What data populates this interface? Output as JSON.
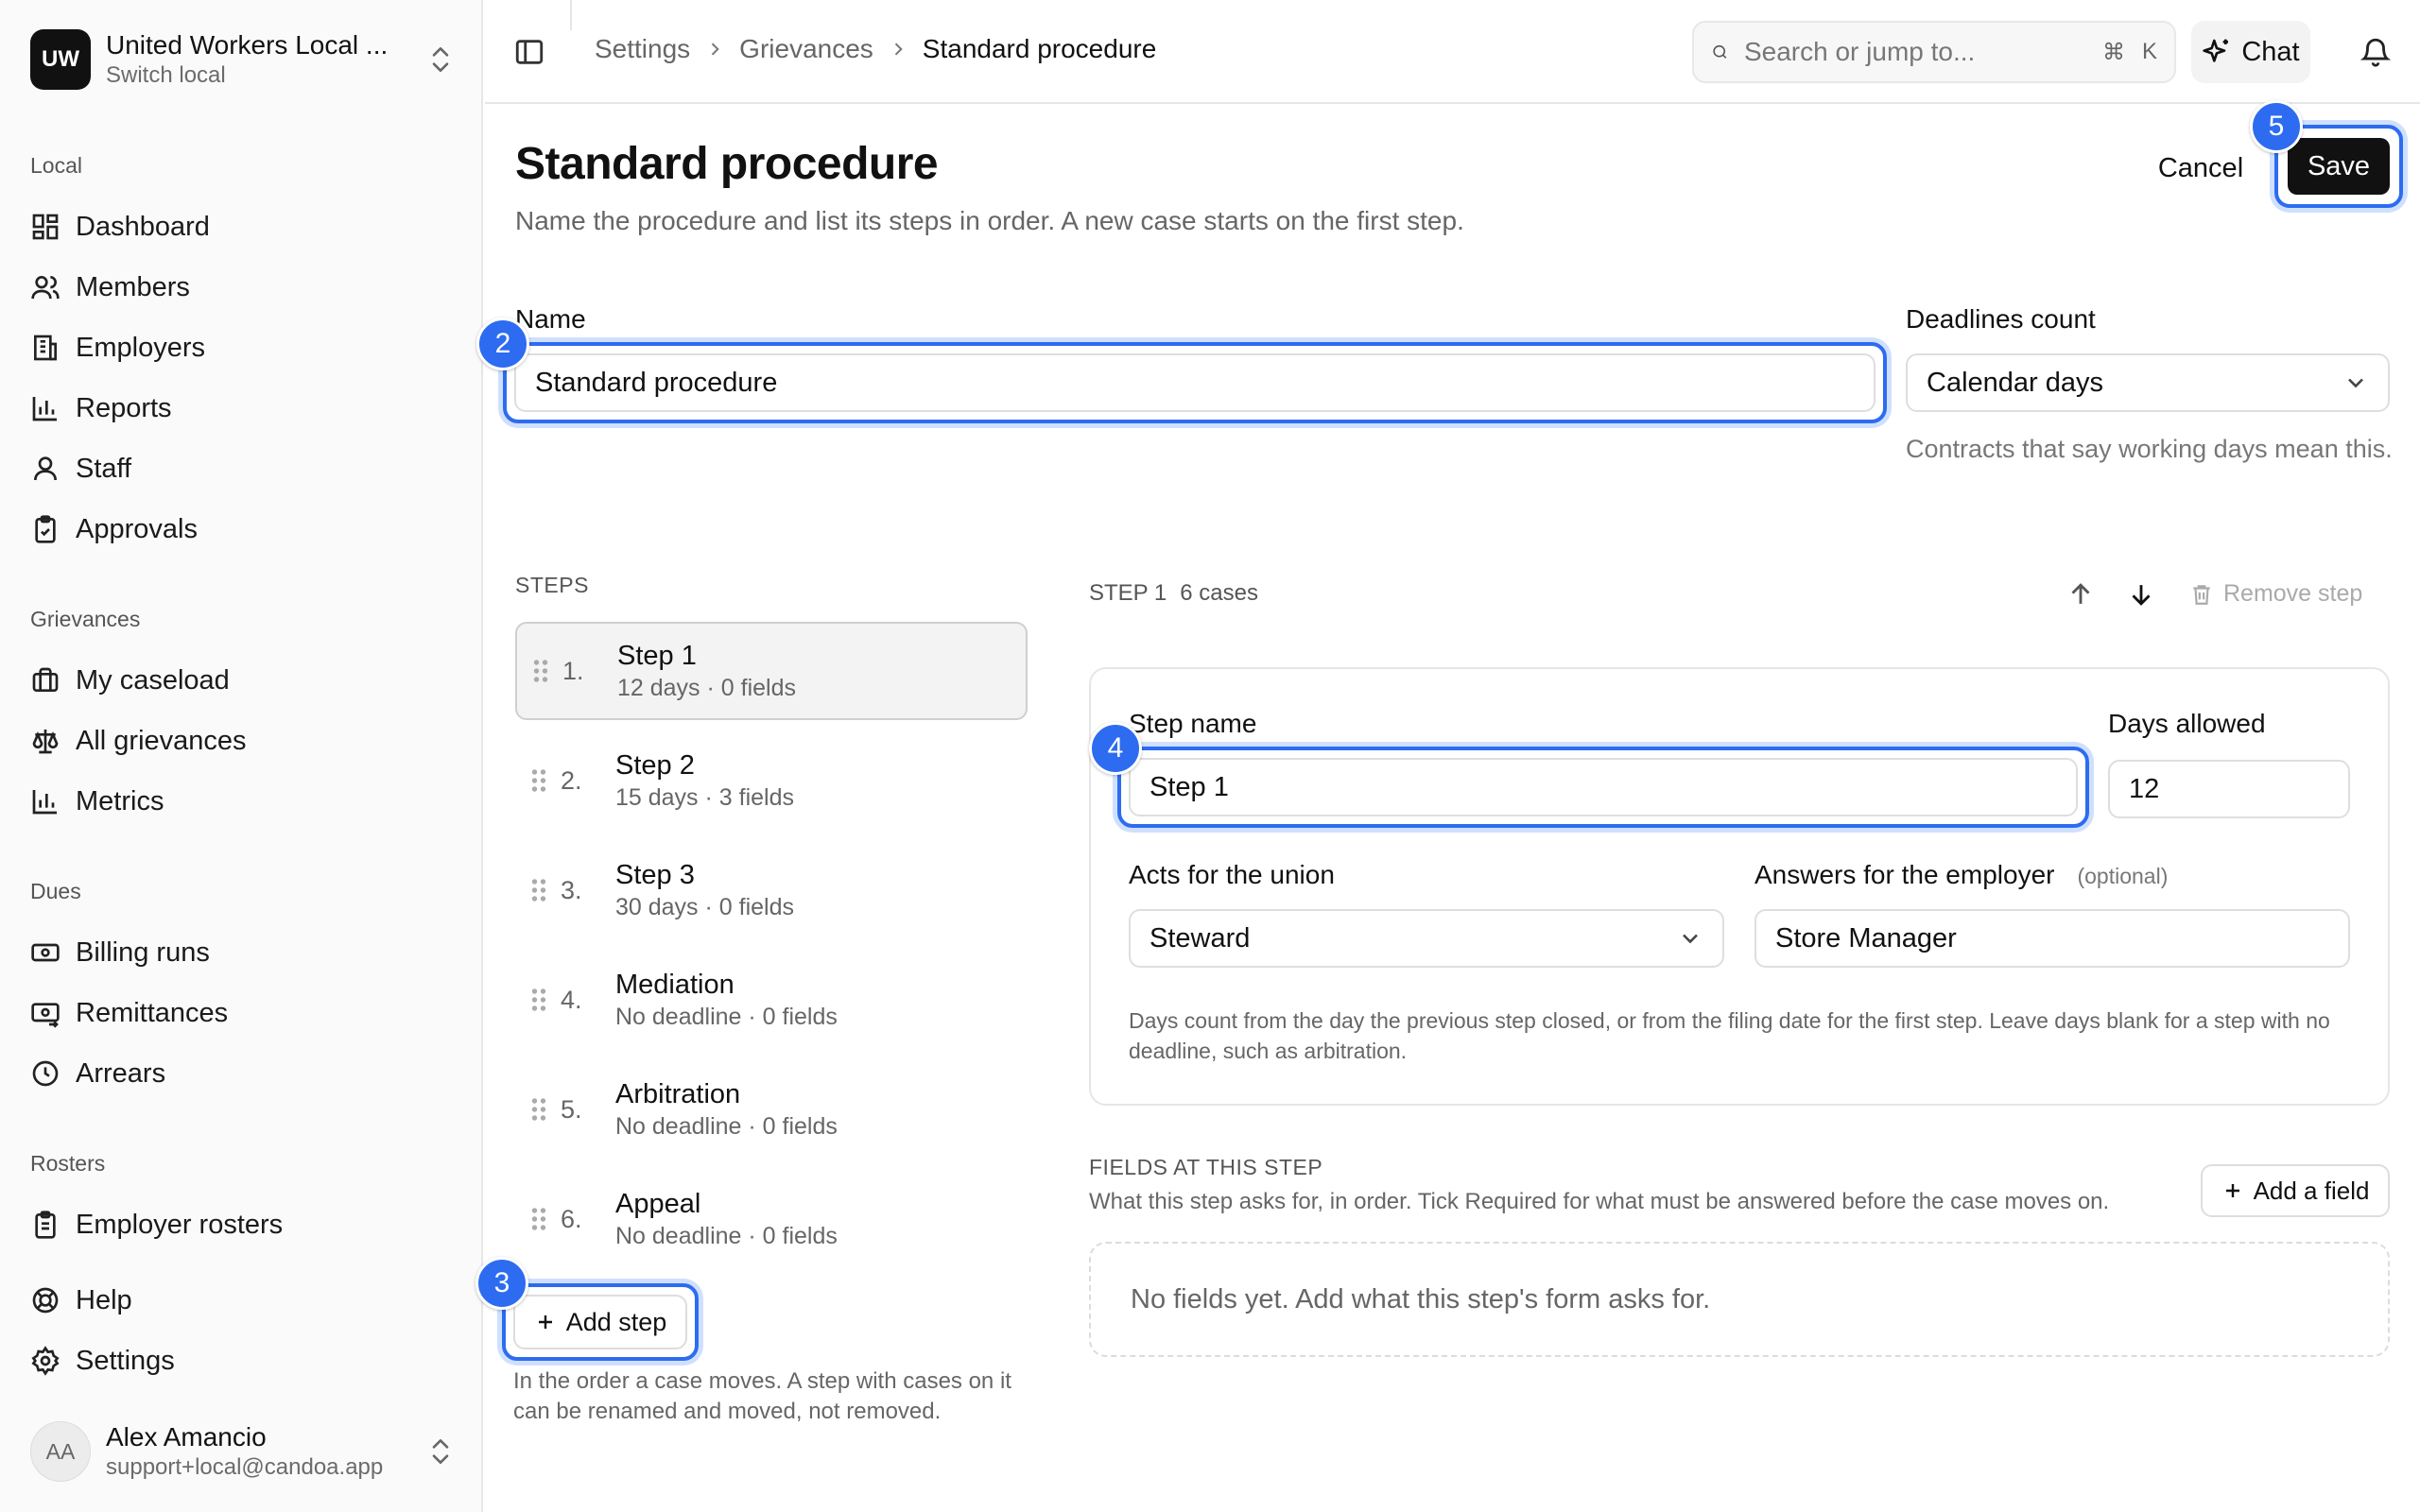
{
  "org": {
    "initials": "UW",
    "name": "United Workers Local ...",
    "switch_label": "Switch local"
  },
  "nav": {
    "local_label": "Local",
    "local_items": [
      "Dashboard",
      "Members",
      "Employers",
      "Reports",
      "Staff",
      "Approvals"
    ],
    "grievances_label": "Grievances",
    "grievances_items": [
      "My caseload",
      "All grievances",
      "Metrics"
    ],
    "dues_label": "Dues",
    "dues_items": [
      "Billing runs",
      "Remittances",
      "Arrears"
    ],
    "rosters_label": "Rosters",
    "rosters_items": [
      "Employer rosters"
    ],
    "help": "Help",
    "settings": "Settings"
  },
  "user": {
    "initials": "AA",
    "name": "Alex Amancio",
    "email": "support+local@candoa.app"
  },
  "breadcrumb": [
    "Settings",
    "Grievances",
    "Standard procedure"
  ],
  "search": {
    "placeholder": "Search or jump to...",
    "kbd_cmd": "⌘",
    "kbd_key": "K"
  },
  "chat_label": "Chat",
  "page": {
    "title": "Standard procedure",
    "subtitle": "Name the procedure and list its steps in order. A new case starts on the first step.",
    "cancel": "Cancel",
    "save": "Save"
  },
  "form": {
    "name_label": "Name",
    "name_value": "Standard procedure",
    "deadlines_label": "Deadlines count",
    "deadlines_value": "Calendar days",
    "deadlines_help": "Contracts that say working days mean this."
  },
  "steps_label": "STEPS",
  "steps": [
    {
      "num": "1.",
      "name": "Step 1",
      "meta": "12 days · 0 fields"
    },
    {
      "num": "2.",
      "name": "Step 2",
      "meta": "15 days · 3 fields"
    },
    {
      "num": "3.",
      "name": "Step 3",
      "meta": "30 days · 0 fields"
    },
    {
      "num": "4.",
      "name": "Mediation",
      "meta": "No deadline · 0 fields"
    },
    {
      "num": "5.",
      "name": "Arbitration",
      "meta": "No deadline · 0 fields"
    },
    {
      "num": "6.",
      "name": "Appeal",
      "meta": "No deadline · 0 fields"
    }
  ],
  "add_step": "Add step",
  "steps_help": "In the order a case moves. A step with cases on it can be renamed and moved, not removed.",
  "detail": {
    "step_label": "STEP 1",
    "case_count": "6 cases",
    "remove_step": "Remove step",
    "step_name_label": "Step name",
    "step_name_value": "Step 1",
    "days_label": "Days allowed",
    "days_value": "12",
    "union_label": "Acts for the union",
    "union_value": "Steward",
    "employer_label": "Answers for the employer",
    "optional": "(optional)",
    "employer_value": "Store Manager",
    "help": "Days count from the day the previous step closed, or from the filing date for the first step. Leave days blank for a step with no deadline, such as arbitration."
  },
  "fields": {
    "title": "FIELDS AT THIS STEP",
    "subtitle": "What this step asks for, in order. Tick Required for what must be answered before the case moves on.",
    "add": "Add a field",
    "empty": "No fields yet. Add what this step's form asks for."
  },
  "annotations": [
    "2",
    "3",
    "4",
    "5"
  ],
  "colors": {
    "accent": "#2d6cf0",
    "primary_button": "#111111"
  }
}
